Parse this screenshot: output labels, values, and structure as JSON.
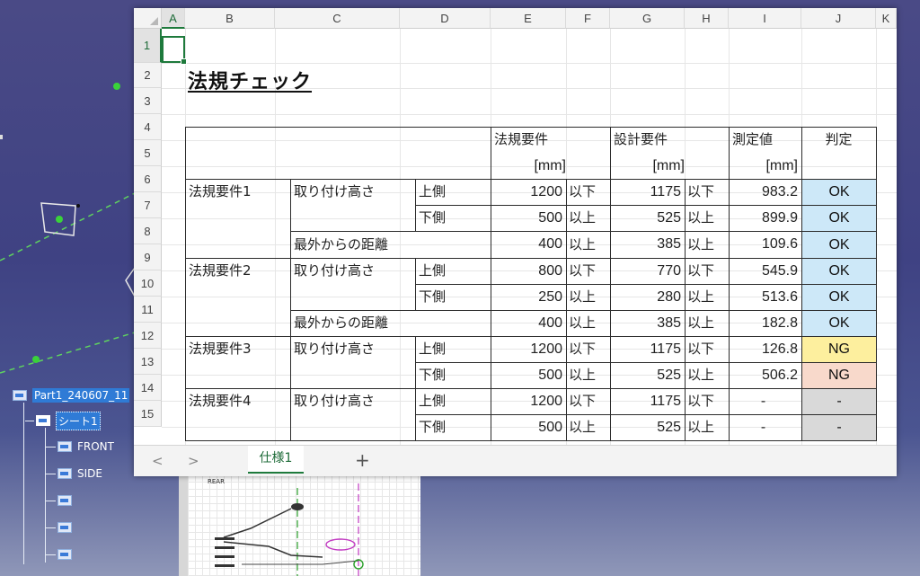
{
  "cad_tree": {
    "root": "Part1_240607_11",
    "sheet": "シート1",
    "views": [
      "FRONT",
      "SIDE",
      "",
      "",
      ""
    ]
  },
  "drawing": {
    "title": "REAR"
  },
  "sheet": {
    "columns": [
      "A",
      "B",
      "C",
      "D",
      "E",
      "F",
      "G",
      "H",
      "I",
      "J",
      "K"
    ],
    "rows": [
      "1",
      "2",
      "3",
      "4",
      "5",
      "6",
      "7",
      "8",
      "9",
      "10",
      "11",
      "12",
      "13",
      "14",
      "15"
    ],
    "title": "法規チェック",
    "headers": {
      "law_req": "法規要件",
      "law_unit": "[mm]",
      "design_req": "設計要件",
      "design_unit": "[mm]",
      "measured": "測定値",
      "measured_unit": "[mm]",
      "judge": "判定"
    },
    "groups": [
      "法規要件1",
      "法規要件2",
      "法規要件3",
      "法規要件4"
    ],
    "items": {
      "mount_height": "取り付け高さ",
      "distance": "最外からの距離"
    },
    "sides": {
      "upper": "上側",
      "lower": "下側"
    },
    "rows_data": [
      {
        "law": "1200",
        "law_cond": "以下",
        "design": "1175",
        "design_cond": "以下",
        "measured": "983.2",
        "result": "OK"
      },
      {
        "law": "500",
        "law_cond": "以上",
        "design": "525",
        "design_cond": "以上",
        "measured": "899.9",
        "result": "OK"
      },
      {
        "law": "400",
        "law_cond": "以上",
        "design": "385",
        "design_cond": "以上",
        "measured": "109.6",
        "result": "OK"
      },
      {
        "law": "800",
        "law_cond": "以下",
        "design": "770",
        "design_cond": "以下",
        "measured": "545.9",
        "result": "OK"
      },
      {
        "law": "250",
        "law_cond": "以上",
        "design": "280",
        "design_cond": "以上",
        "measured": "513.6",
        "result": "OK"
      },
      {
        "law": "400",
        "law_cond": "以上",
        "design": "385",
        "design_cond": "以上",
        "measured": "182.8",
        "result": "OK"
      },
      {
        "law": "1200",
        "law_cond": "以下",
        "design": "1175",
        "design_cond": "以下",
        "measured": "126.8",
        "result": "NG"
      },
      {
        "law": "500",
        "law_cond": "以上",
        "design": "525",
        "design_cond": "以上",
        "measured": "506.2",
        "result": "NG"
      },
      {
        "law": "1200",
        "law_cond": "以下",
        "design": "1175",
        "design_cond": "以下",
        "measured": "-",
        "result": "-"
      },
      {
        "law": "500",
        "law_cond": "以上",
        "design": "525",
        "design_cond": "以上",
        "measured": "-",
        "result": "-"
      }
    ],
    "result_colors": {
      "ok": "#cde8f8",
      "ng_warn": "#fdef9e",
      "ng": "#f8d9cb",
      "none": "#d9d9d9"
    }
  },
  "tabs": {
    "prev": "<",
    "next": ">",
    "active": "仕様1",
    "add": "+"
  }
}
